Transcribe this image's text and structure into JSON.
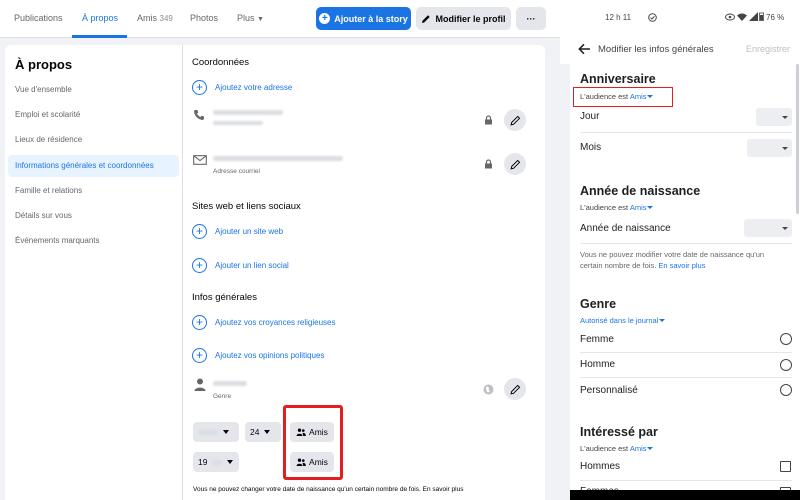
{
  "desktop": {
    "nav": {
      "tabs": [
        {
          "label": "Publications"
        },
        {
          "label": "À propos"
        },
        {
          "label": "Amis",
          "count": "349"
        },
        {
          "label": "Photos"
        },
        {
          "label": "Plus"
        }
      ],
      "story_button": "Ajouter à la story",
      "edit_profile_button": "Modifier le profil",
      "more_button": "···"
    },
    "sidebar": {
      "title": "À propos",
      "items": [
        {
          "label": "Vue d'ensemble"
        },
        {
          "label": "Emploi et scolarité"
        },
        {
          "label": "Lieux de résidence"
        },
        {
          "label": "Informations générales et coordonnées"
        },
        {
          "label": "Famille et relations"
        },
        {
          "label": "Détails sur vous"
        },
        {
          "label": "Événements marquants"
        }
      ]
    },
    "content": {
      "contact_title": "Coordonnées",
      "add_address": "Ajoutez votre adresse",
      "email_sublabel": "Adresse courriel",
      "websites_title": "Sites web et liens sociaux",
      "add_website": "Ajouter un site web",
      "add_social": "Ajouter un lien social",
      "general_title": "Infos générales",
      "add_religion": "Ajoutez vos croyances religieuses",
      "add_politics": "Ajoutez vos opinions politiques",
      "gender_sublabel": "Genre",
      "day_value": "24",
      "year_value": "19",
      "audience_1": "Amis",
      "audience_2": "Amis",
      "footnote": "Vous ne pouvez changer votre date de naissance qu'un certain nombre de fois. En savoir plus"
    }
  },
  "mobile": {
    "status": {
      "time": "12 h 11",
      "battery": "76 %"
    },
    "header": {
      "title": "Modifier les infos générales",
      "save": "Enregistrer"
    },
    "birthday": {
      "title": "Anniversaire",
      "audience_prefix": "L'audience est ",
      "audience_value": "Amis",
      "day_label": "Jour",
      "month_label": "Mois"
    },
    "birth_year": {
      "title": "Année de naissance",
      "audience_prefix": "L'audience est ",
      "audience_value": "Amis",
      "year_label": "Année de naissance",
      "note": "Vous ne pouvez modifier votre date de naissance qu'un certain nombre de fois. ",
      "note_link": "En savoir plus"
    },
    "gender": {
      "title": "Genre",
      "audience_value": "Autorisé dans le journal",
      "options": [
        "Femme",
        "Homme",
        "Personnalisé"
      ]
    },
    "interested": {
      "title": "Intéressé par",
      "audience_prefix": "L'audience est ",
      "audience_value": "Amis",
      "options": [
        "Hommes",
        "Femmes"
      ]
    }
  },
  "colors": {
    "accent": "#1b74e4",
    "highlight_box": "#e41e1e",
    "page_bg": "#f0f2f5"
  }
}
